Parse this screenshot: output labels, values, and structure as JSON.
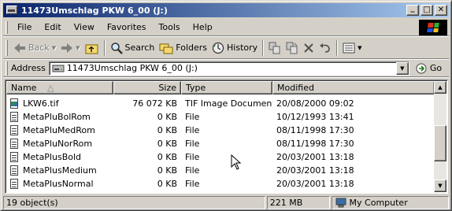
{
  "window": {
    "title": "11473Umschlag PKW 6_00 (J:)"
  },
  "title_buttons": {
    "minimize": "_",
    "maximize": "□",
    "close": "✕"
  },
  "menu": [
    "File",
    "Edit",
    "View",
    "Favorites",
    "Tools",
    "Help"
  ],
  "toolbar": {
    "back": "Back",
    "search": "Search",
    "folders": "Folders",
    "history": "History"
  },
  "address": {
    "label": "Address",
    "value": "11473Umschlag PKW 6_00 (J:)",
    "go": "Go"
  },
  "columns": {
    "name": "Name",
    "size": "Size",
    "type": "Type",
    "modified": "Modified"
  },
  "files": [
    {
      "name": "LKW6.tif",
      "size": "76 072 KB",
      "type": "TIF Image Document",
      "modified": "20/08/2000 09:02",
      "icon": "tif"
    },
    {
      "name": "MetaPluBolRom",
      "size": "0 KB",
      "type": "File",
      "modified": "10/12/1993 13:41",
      "icon": "file"
    },
    {
      "name": "MetaPluMedRom",
      "size": "0 KB",
      "type": "File",
      "modified": "08/11/1998 17:30",
      "icon": "file"
    },
    {
      "name": "MetaPluNorRom",
      "size": "0 KB",
      "type": "File",
      "modified": "08/11/1998 17:30",
      "icon": "file"
    },
    {
      "name": "MetaPlusBold",
      "size": "0 KB",
      "type": "File",
      "modified": "20/03/2001 13:18",
      "icon": "file"
    },
    {
      "name": "MetaPlusMedium",
      "size": "0 KB",
      "type": "File",
      "modified": "20/03/2001 13:18",
      "icon": "file"
    },
    {
      "name": "MetaPlusNormal",
      "size": "0 KB",
      "type": "File",
      "modified": "20/03/2001 13:18",
      "icon": "file"
    }
  ],
  "status": {
    "objects": "19 object(s)",
    "size": "221 MB",
    "location": "My Computer"
  }
}
